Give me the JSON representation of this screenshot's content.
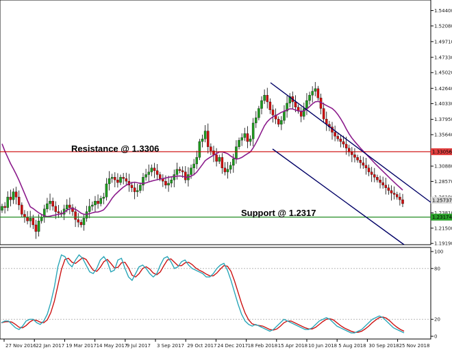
{
  "chart_data": {
    "type": "candlestick",
    "title": "",
    "price_axis": {
      "ylim": [
        1.19,
        1.56
      ],
      "ticks": [
        "1.54400",
        "1.52080",
        "1.49710",
        "1.47330",
        "1.45020",
        "1.42640",
        "1.40330",
        "1.37950",
        "1.35640",
        "1.33056",
        "1.30880",
        "1.28570",
        "1.26190",
        "1.25737",
        "1.23810",
        "1.23174",
        "1.21500",
        "1.19190"
      ],
      "tick_values": [
        1.544,
        1.5208,
        1.4971,
        1.4733,
        1.4502,
        1.4264,
        1.4033,
        1.3795,
        1.3564,
        1.33056,
        1.3088,
        1.2857,
        1.2619,
        1.25737,
        1.2381,
        1.23174,
        1.215,
        1.1919
      ]
    },
    "time_axis": {
      "labels": [
        "27 Nov 2016",
        "22 Jan 2017",
        "19 Mar 2017",
        "14 May 2017",
        "9 Jul 2017",
        "3 Sep 2017",
        "29 Oct 2017",
        "24 Dec 2017",
        "18 Feb 2018",
        "15 Apr 2018",
        "10 Jun 2018",
        "5 Aug 2018",
        "30 Sep 2018",
        "25 Nov 2018"
      ],
      "label_index": [
        0,
        8,
        16,
        24,
        32,
        40,
        48,
        56,
        64,
        72,
        80,
        88,
        96,
        104
      ]
    },
    "candles_close": [
      1.248,
      1.246,
      1.262,
      1.258,
      1.27,
      1.262,
      1.25,
      1.236,
      1.232,
      1.226,
      1.23,
      1.22,
      1.21,
      1.226,
      1.232,
      1.244,
      1.252,
      1.256,
      1.248,
      1.24,
      1.238,
      1.236,
      1.244,
      1.25,
      1.246,
      1.24,
      1.228,
      1.224,
      1.22,
      1.23,
      1.24,
      1.248,
      1.25,
      1.256,
      1.252,
      1.26,
      1.262,
      1.282,
      1.29,
      1.292,
      1.288,
      1.284,
      1.292,
      1.29,
      1.286,
      1.28,
      1.276,
      1.27,
      1.272,
      1.28,
      1.292,
      1.296,
      1.3,
      1.306,
      1.302,
      1.296,
      1.29,
      1.286,
      1.28,
      1.283,
      1.288,
      1.296,
      1.304,
      1.302,
      1.3,
      1.288,
      1.296,
      1.306,
      1.312,
      1.322,
      1.346,
      1.35,
      1.362,
      1.338,
      1.332,
      1.326,
      1.316,
      1.322,
      1.306,
      1.3,
      1.304,
      1.31,
      1.32,
      1.338,
      1.348,
      1.352,
      1.358,
      1.346,
      1.35,
      1.374,
      1.382,
      1.396,
      1.408,
      1.416,
      1.406,
      1.394,
      1.386,
      1.38,
      1.372,
      1.378,
      1.392,
      1.404,
      1.414,
      1.406,
      1.398,
      1.392,
      1.384,
      1.396,
      1.408,
      1.416,
      1.422,
      1.426,
      1.412,
      1.396,
      1.38,
      1.372,
      1.368,
      1.36,
      1.354,
      1.35,
      1.346,
      1.342,
      1.336,
      1.33,
      1.326,
      1.322,
      1.318,
      1.314,
      1.31,
      1.306,
      1.3,
      1.296,
      1.292,
      1.288,
      1.284,
      1.28,
      1.276,
      1.272,
      1.268,
      1.266,
      1.262,
      1.258,
      1.252
    ],
    "moving_average": {
      "color": "#8b1a8b"
    },
    "resistance": {
      "label": "Resistance @ 1.3306",
      "value": 1.3306,
      "color": "#cc0000"
    },
    "support": {
      "label": "Support @ 1.2317",
      "value": 1.2317,
      "color": "#228b22"
    },
    "channel": {
      "color": "#000066"
    },
    "current_price_tag": "1.25737",
    "resistance_tag": "1.33056",
    "support_tag": "1.23174",
    "oscillator": {
      "type": "stochastic",
      "ylim": [
        0,
        100
      ],
      "ticks": [
        "100",
        "80",
        "20",
        "0"
      ],
      "tick_values": [
        100,
        80,
        20,
        0
      ],
      "levels": [
        80,
        20
      ],
      "k_color": "#2aa6b8",
      "d_color": "#cc1111",
      "k": [
        16,
        18,
        18,
        14,
        10,
        8,
        12,
        18,
        20,
        20,
        16,
        14,
        18,
        26,
        40,
        58,
        82,
        96,
        94,
        86,
        82,
        90,
        96,
        92,
        84,
        76,
        74,
        80,
        90,
        94,
        88,
        76,
        78,
        90,
        92,
        80,
        70,
        66,
        74,
        82,
        84,
        80,
        74,
        70,
        74,
        84,
        92,
        94,
        88,
        80,
        82,
        88,
        90,
        84,
        80,
        78,
        76,
        74,
        70,
        70,
        74,
        80,
        84,
        86,
        78,
        66,
        52,
        38,
        26,
        18,
        14,
        12,
        14,
        12,
        10,
        8,
        6,
        8,
        12,
        16,
        20,
        18,
        16,
        14,
        12,
        10,
        8,
        8,
        10,
        14,
        18,
        20,
        22,
        20,
        16,
        12,
        10,
        8,
        6,
        4,
        4,
        6,
        8,
        12,
        16,
        20,
        22,
        24,
        22,
        18,
        14,
        10,
        8,
        6,
        4
      ]
    }
  }
}
